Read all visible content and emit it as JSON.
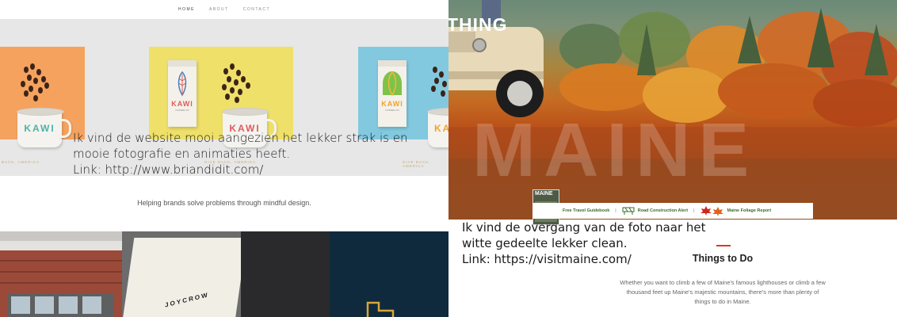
{
  "left": {
    "nav": {
      "items": [
        {
          "label": "HOME",
          "active": true
        },
        {
          "label": "ABOUT",
          "active": false
        },
        {
          "label": "CONTACT",
          "active": false
        }
      ]
    },
    "hero": {
      "mug_brand_1": "KAWI",
      "bag_brand": "KAWI",
      "bag_sub": "COFFEE CO",
      "mug_brand_2": "KAWI",
      "bag_brand_2": "KAWI",
      "bag_sub_2": "COFFEE CO",
      "mug_brand_3": "KA",
      "caption_1": "BACK, AMERICA",
      "caption_2": "GIVE BACK, AMERICA",
      "caption_3": "GIVE BACK, AMERICA"
    },
    "annotation": {
      "line1": "Ik vind de website mooi aangezien het lekker strak is en",
      "line2": "mooie fotografie en animaties heeft.",
      "line3": "Link: http://www.briandidit.com/"
    },
    "tagline": "Helping brands solve problems through mindful design.",
    "tote_text": "JOYCROW"
  },
  "right": {
    "hero_heading_partial": "THING",
    "watermark": "MAINE",
    "magazine_title": "MAINE",
    "links": [
      {
        "label": "Free Travel Guidebook"
      },
      {
        "label": "Road Construction Alert"
      },
      {
        "label": "Maine Foliage Report"
      }
    ],
    "annotation": {
      "line1": "Ik vind de overgang van de foto naar het",
      "line2": "witte gedeelte lekker clean.",
      "line3": "Link: https://visitmaine.com/"
    },
    "section_title": "Things to Do",
    "paragraph": "Whether you want to climb a few of Maine's famous lighthouses or climb a few thousand feet up Maine's majestic mountains, there's more than plenty of things to do in Maine."
  }
}
